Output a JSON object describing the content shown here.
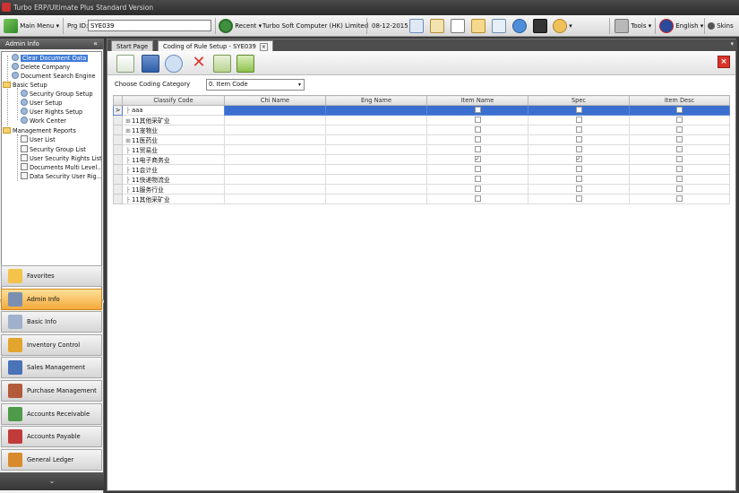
{
  "window": {
    "title": "Turbo ERP/Ultimate Plus Standard Version"
  },
  "toolbar": {
    "main_menu": "Main Menu",
    "prg_id_label": "Prg ID:",
    "prg_id_value": "SYE039",
    "recent": "Recent",
    "company": "Turbo Soft Computer (HK) Limited",
    "date": "08-12-2015",
    "tools": "Tools",
    "language": "English",
    "skins": "Skins"
  },
  "left_panel": {
    "title": "Admin Info",
    "tree": [
      {
        "label": "Clear Document Data",
        "selected": true
      },
      {
        "label": "Delete Company"
      },
      {
        "label": "Document Search Engine"
      },
      {
        "label": "Basic Setup"
      },
      {
        "label": "Security Group Setup"
      },
      {
        "label": "User Setup"
      },
      {
        "label": "User Rights Setup"
      },
      {
        "label": "Work Center"
      },
      {
        "label": "Management Reports"
      },
      {
        "label": "User List"
      },
      {
        "label": "Security Group List"
      },
      {
        "label": "User Security Rights List"
      },
      {
        "label": "Documents Multi Level..."
      },
      {
        "label": "Data Security User Rig..."
      }
    ],
    "nav": [
      {
        "label": "Favorites",
        "icon": "star-icon",
        "color": "#f3c34a"
      },
      {
        "label": "Admin Info",
        "icon": "admin-user-icon",
        "color": "#7a8fb0",
        "active": true
      },
      {
        "label": "Basic Info",
        "icon": "basic-info-icon",
        "color": "#9fb1cc"
      },
      {
        "label": "Inventory Control",
        "icon": "inventory-box-icon",
        "color": "#e3a52d"
      },
      {
        "label": "Sales Management",
        "icon": "sales-icon",
        "color": "#4a73b8"
      },
      {
        "label": "Purchase Management",
        "icon": "purchase-cart-icon",
        "color": "#b35a3a"
      },
      {
        "label": "Accounts Receivable",
        "icon": "receivable-icon",
        "color": "#4f9a4a"
      },
      {
        "label": "Accounts Payable",
        "icon": "payable-icon",
        "color": "#c23b3b"
      },
      {
        "label": "General Ledger",
        "icon": "ledger-book-icon",
        "color": "#d98a2c"
      }
    ]
  },
  "tabs": [
    {
      "label": "Start Page"
    },
    {
      "label": "Coding of Rule Setup - SYE039",
      "active": true
    }
  ],
  "form": {
    "category_label": "Choose Coding Category",
    "category_value": "0. Item Code"
  },
  "grid": {
    "columns": [
      "Classify Code",
      "Chi Name",
      "Eng Name",
      "Item Name",
      "Spec",
      "Item Desc"
    ],
    "rows": [
      {
        "code": "aaa",
        "item_name": false,
        "spec": false,
        "item_desc": false,
        "selected": true,
        "indicator": ">"
      },
      {
        "code": "11其他采矿业",
        "expand": true,
        "item_name": false,
        "spec": false,
        "item_desc": false
      },
      {
        "code": "11宠物业",
        "expand": true,
        "item_name": false,
        "spec": false,
        "item_desc": false
      },
      {
        "code": "11医药业",
        "expand": true,
        "item_name": false,
        "spec": false,
        "item_desc": false
      },
      {
        "code": "11贸易业",
        "item_name": false,
        "spec": false,
        "item_desc": false
      },
      {
        "code": "11电子商务业",
        "item_name": true,
        "spec": true,
        "item_desc": false
      },
      {
        "code": "11会计业",
        "item_name": false,
        "spec": false,
        "item_desc": false
      },
      {
        "code": "11快递物流业",
        "item_name": false,
        "spec": false,
        "item_desc": false
      },
      {
        "code": "11服务行业",
        "item_name": false,
        "spec": false,
        "item_desc": false
      },
      {
        "code": "11其他采矿业",
        "item_name": false,
        "spec": false,
        "item_desc": false
      }
    ]
  }
}
